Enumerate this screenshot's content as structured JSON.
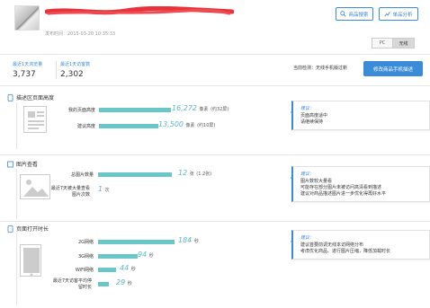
{
  "header": {
    "publish_time": "发布时间：2015-03-20 10:35:33",
    "buttons": {
      "view_product": "商品搜索",
      "product_analysis": "单品分析"
    },
    "toggle": {
      "pc": "PC",
      "mobile": "无线"
    }
  },
  "stats": {
    "views_label": "最近1天浏览量",
    "views_value": "3,737",
    "visitors_label": "最近1天访客数",
    "visitors_value": "2,302",
    "status_text": "当前检测：无线手机版过新",
    "optimize_button": "修改商品手机描述"
  },
  "sections": {
    "height": {
      "title": "描述区页面高度",
      "rows": [
        {
          "label": "我的页面高度",
          "value": "16,272",
          "unit": "像素",
          "note": "(约32屏)",
          "fraction": 1.0
        },
        {
          "label": "建议高度",
          "value": "13,500",
          "unit": "像素",
          "note": "(约10屏)",
          "fraction": 0.83
        }
      ],
      "tip": {
        "title": "建议：",
        "lines": [
          "页面高度适中",
          "请继续保持"
        ]
      }
    },
    "images": {
      "title": "图片查看",
      "rows": [
        {
          "label": "总图片数量",
          "value": "12",
          "unit": "张",
          "note": "(1.2张)",
          "fraction": 0.95
        },
        {
          "label": "最近7天被大量查看图片次数",
          "value": "1",
          "unit": "次",
          "note": "",
          "fraction": 0
        }
      ],
      "tip": {
        "title": "建议：",
        "lines": [
          "图片数较大量看",
          "可能存在部分图片未被访问高清看到描述",
          "建议对商品描述图片进一步优化得再好水平"
        ]
      }
    },
    "load": {
      "title": "页面打开时长",
      "rows": [
        {
          "label": "2G网络",
          "value": "184",
          "unit": "秒",
          "fraction": 0.72
        },
        {
          "label": "3G网络",
          "value": "94",
          "unit": "秒",
          "fraction": 0.37
        },
        {
          "label": "WiFi网络",
          "value": "44",
          "unit": "秒",
          "fraction": 0.17
        },
        {
          "label": "最近7天访客平均停留时长",
          "value": "29",
          "unit": "秒",
          "fraction": 0.1
        }
      ],
      "tip": {
        "title": "建议：",
        "lines": [
          "建议首要前调无线本访网络分布",
          "考虑优化商品、进行图片压缩，降低加载时长"
        ]
      }
    }
  },
  "colors": {
    "accent": "#3a8bd8",
    "bar": "#69c6c9",
    "value_text": "#5bb8c8"
  }
}
